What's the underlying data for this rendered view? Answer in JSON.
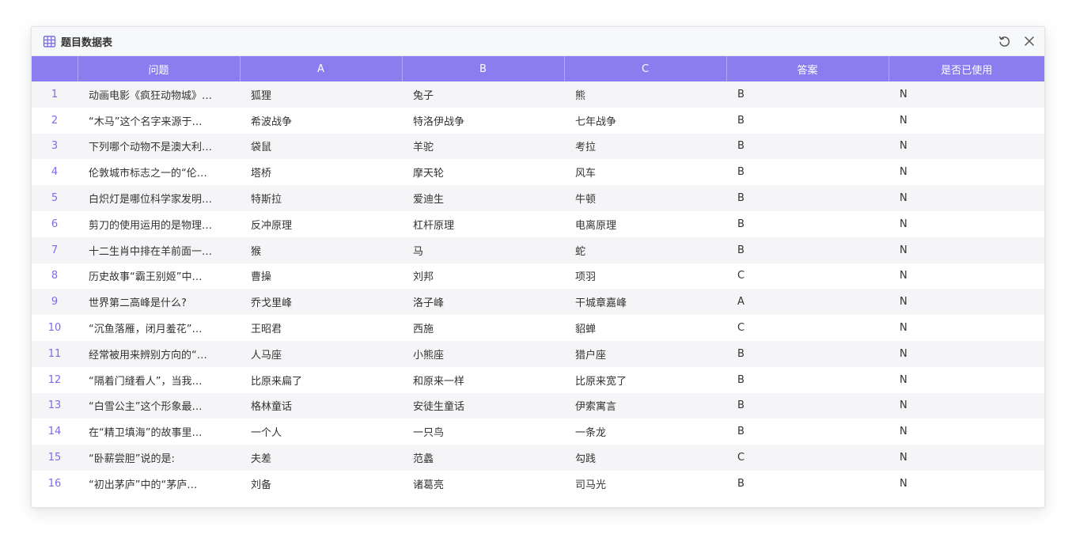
{
  "window": {
    "title": "题目数据表",
    "icons": {
      "title": "table-icon",
      "refresh": "refresh-icon",
      "close": "close-icon"
    }
  },
  "colors": {
    "header_bg": "#8b7cf0",
    "index_text": "#7a6ce8",
    "stripe": "#f5f5f7"
  },
  "table": {
    "columns": [
      "",
      "问题",
      "A",
      "B",
      "C",
      "答案",
      "是否已使用"
    ],
    "rows": [
      [
        "1",
        "动画电影《疯狂动物城》…",
        "狐狸",
        "兔子",
        "熊",
        "B",
        "N"
      ],
      [
        "2",
        "“木马”这个名字来源于…",
        "希波战争",
        "特洛伊战争",
        "七年战争",
        "B",
        "N"
      ],
      [
        "3",
        "下列哪个动物不是澳大利…",
        "袋鼠",
        "羊驼",
        "考拉",
        "B",
        "N"
      ],
      [
        "4",
        "伦敦城市标志之一的“伦…",
        "塔桥",
        "摩天轮",
        "风车",
        "B",
        "N"
      ],
      [
        "5",
        "白炽灯是哪位科学家发明…",
        "特斯拉",
        "爱迪生",
        "牛顿",
        "B",
        "N"
      ],
      [
        "6",
        "剪刀的使用运用的是物理…",
        "反冲原理",
        "杠杆原理",
        "电离原理",
        "B",
        "N"
      ],
      [
        "7",
        "十二生肖中排在羊前面一…",
        "猴",
        "马",
        "蛇",
        "B",
        "N"
      ],
      [
        "8",
        "历史故事“霸王别姬”中…",
        "曹操",
        "刘邦",
        "项羽",
        "C",
        "N"
      ],
      [
        "9",
        "世界第二高峰是什么?",
        "乔戈里峰",
        "洛子峰",
        "干城章嘉峰",
        "A",
        "N"
      ],
      [
        "10",
        "“沉鱼落雁，闭月羞花”…",
        "王昭君",
        "西施",
        "貂蝉",
        "C",
        "N"
      ],
      [
        "11",
        "经常被用来辨别方向的“…",
        "人马座",
        "小熊座",
        "猎户座",
        "B",
        "N"
      ],
      [
        "12",
        "“隔着门缝看人”，当我…",
        "比原来扁了",
        "和原来一样",
        "比原来宽了",
        "B",
        "N"
      ],
      [
        "13",
        "“白雪公主”这个形象最…",
        "格林童话",
        "安徒生童话",
        "伊索寓言",
        "B",
        "N"
      ],
      [
        "14",
        "在“精卫填海”的故事里…",
        "一个人",
        "一只鸟",
        "一条龙",
        "B",
        "N"
      ],
      [
        "15",
        "“卧薪尝胆”说的是:",
        "夫差",
        "范蠡",
        "勾践",
        "C",
        "N"
      ],
      [
        "16",
        "“初出茅庐”中的“茅庐…",
        "刘备",
        "诸葛亮",
        "司马光",
        "B",
        "N"
      ]
    ]
  }
}
